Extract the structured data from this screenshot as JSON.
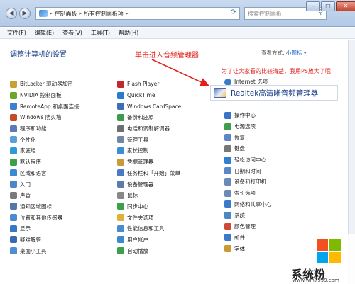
{
  "titlebar": {
    "breadcrumb": [
      "控制面板",
      "所有控制面板项"
    ],
    "search_placeholder": "搜索控制面板",
    "back_glyph": "◀",
    "forward_glyph": "▶",
    "min_glyph": "–",
    "max_glyph": "□",
    "close_glyph": "✕"
  },
  "menubar": [
    "文件(F)",
    "编辑(E)",
    "查看(V)",
    "工具(T)",
    "帮助(H)"
  ],
  "content": {
    "heading": "调整计算机的设置",
    "view_by_label": "查看方式:",
    "view_by_value": "小图标 ▾"
  },
  "annotations": {
    "instruction": "单击进入音频管理器",
    "note": "为了让大家看的比较清楚，我用PS放大了哦"
  },
  "realtek": {
    "label": "Realtek高清晰音频管理器"
  },
  "internet_options": "Internet 选项",
  "columns": [
    [
      {
        "label": "BitLocker 驱动器加密",
        "color": "#c9a034"
      },
      {
        "label": "NVIDIA 控制面板",
        "color": "#6aa825"
      },
      {
        "label": "RemoteApp 和桌面连接",
        "color": "#3f7fd0"
      },
      {
        "label": "Windows 防火墙",
        "color": "#c8482a"
      },
      {
        "label": "程序和功能",
        "color": "#5c7ab8"
      },
      {
        "label": "个性化",
        "color": "#59a0d6"
      },
      {
        "label": "家庭组",
        "color": "#2f9ad8"
      },
      {
        "label": "默认程序",
        "color": "#3aa04a"
      },
      {
        "label": "区域和语言",
        "color": "#3a8ad0"
      },
      {
        "label": "入门",
        "color": "#4a86c8"
      },
      {
        "label": "声音",
        "color": "#7a7a7a"
      },
      {
        "label": "通知区域图标",
        "color": "#5577a6"
      },
      {
        "label": "位置和其他传感器",
        "color": "#4b8bd0"
      },
      {
        "label": "显示",
        "color": "#3478c6"
      },
      {
        "label": "疑难解答",
        "color": "#3a6ab0"
      },
      {
        "label": "桌面小工具",
        "color": "#4d8fd0"
      }
    ],
    [
      {
        "label": "Flash Player",
        "color": "#c1272d"
      },
      {
        "label": "QuickTime",
        "color": "#2a7bd0"
      },
      {
        "label": "Windows CardSpace",
        "color": "#3d6fb8"
      },
      {
        "label": "备份和还原",
        "color": "#3c9a4c"
      },
      {
        "label": "电话和调制解调器",
        "color": "#6f6f6f"
      },
      {
        "label": "管理工具",
        "color": "#6f86a8"
      },
      {
        "label": "家长控制",
        "color": "#3b8fd8"
      },
      {
        "label": "凭据管理器",
        "color": "#c99a35"
      },
      {
        "label": "任务栏和「开始」菜单",
        "color": "#4a7ac0"
      },
      {
        "label": "设备管理器",
        "color": "#5f7aa8"
      },
      {
        "label": "鼠标",
        "color": "#888888"
      },
      {
        "label": "同步中心",
        "color": "#3aa04a"
      },
      {
        "label": "文件夹选项",
        "color": "#e0b23a"
      },
      {
        "label": "性能信息和工具",
        "color": "#4a8ad0"
      },
      {
        "label": "用户帐户",
        "color": "#3a8ad0"
      },
      {
        "label": "自动播放",
        "color": "#3aa04a"
      }
    ],
    [
      {
        "label": "操作中心",
        "color": "#3a74c4"
      },
      {
        "label": "电源选项",
        "color": "#3aa04a"
      },
      {
        "label": "恢复",
        "color": "#5b86c8"
      },
      {
        "label": "键盘",
        "color": "#777777"
      },
      {
        "label": "轻松访问中心",
        "color": "#2f7ed0"
      },
      {
        "label": "日期和时间",
        "color": "#5b86c8"
      },
      {
        "label": "设备和打印机",
        "color": "#6a8ab8"
      },
      {
        "label": "索引选项",
        "color": "#6a8ab8"
      },
      {
        "label": "网络和共享中心",
        "color": "#3a7ac8"
      },
      {
        "label": "系统",
        "color": "#4a86c8"
      },
      {
        "label": "颜色管理",
        "color": "#d0483a"
      },
      {
        "label": "邮件",
        "color": "#3a7ac8"
      },
      {
        "label": "字体",
        "color": "#c99a35"
      }
    ]
  ],
  "watermark": {
    "text": "系统粉",
    "url": "www.win7999.com",
    "logo_colors": [
      "#f25022",
      "#7fba00",
      "#00a4ef",
      "#ffb900"
    ]
  }
}
